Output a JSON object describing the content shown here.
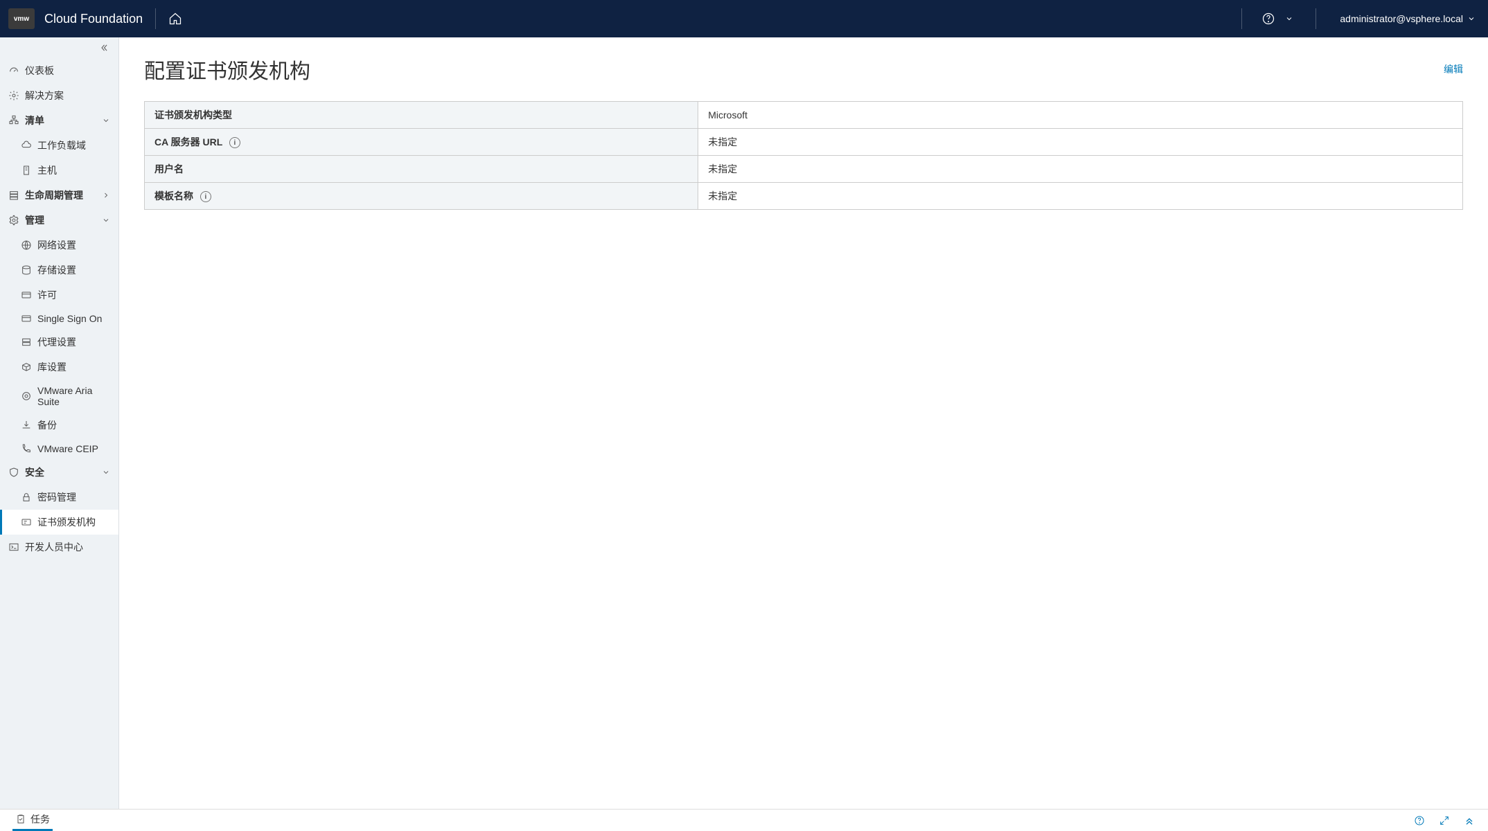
{
  "header": {
    "logo_text": "vmw",
    "product": "Cloud Foundation",
    "user": "administrator@vsphere.local"
  },
  "sidebar": {
    "dashboard": "仪表板",
    "solutions": "解决方案",
    "inventory": "清单",
    "workload_domains": "工作负载域",
    "hosts": "主机",
    "lifecycle": "生命周期管理",
    "administration": "管理",
    "network": "网络设置",
    "storage": "存储设置",
    "licensing": "许可",
    "sso": "Single Sign On",
    "proxy": "代理设置",
    "depot": "库设置",
    "aria": "VMware Aria Suite",
    "backup": "备份",
    "ceip": "VMware CEIP",
    "security": "安全",
    "password_mgmt": "密码管理",
    "cert_authority": "证书颁发机构",
    "dev_center": "开发人员中心"
  },
  "page": {
    "title": "配置证书颁发机构",
    "edit": "编辑",
    "rows": {
      "ca_type_label": "证书颁发机构类型",
      "ca_type_value": "Microsoft",
      "ca_url_label": "CA 服务器 URL",
      "ca_url_value": "未指定",
      "username_label": "用户名",
      "username_value": "未指定",
      "template_label": "模板名称",
      "template_value": "未指定"
    }
  },
  "footer": {
    "tasks": "任务"
  }
}
